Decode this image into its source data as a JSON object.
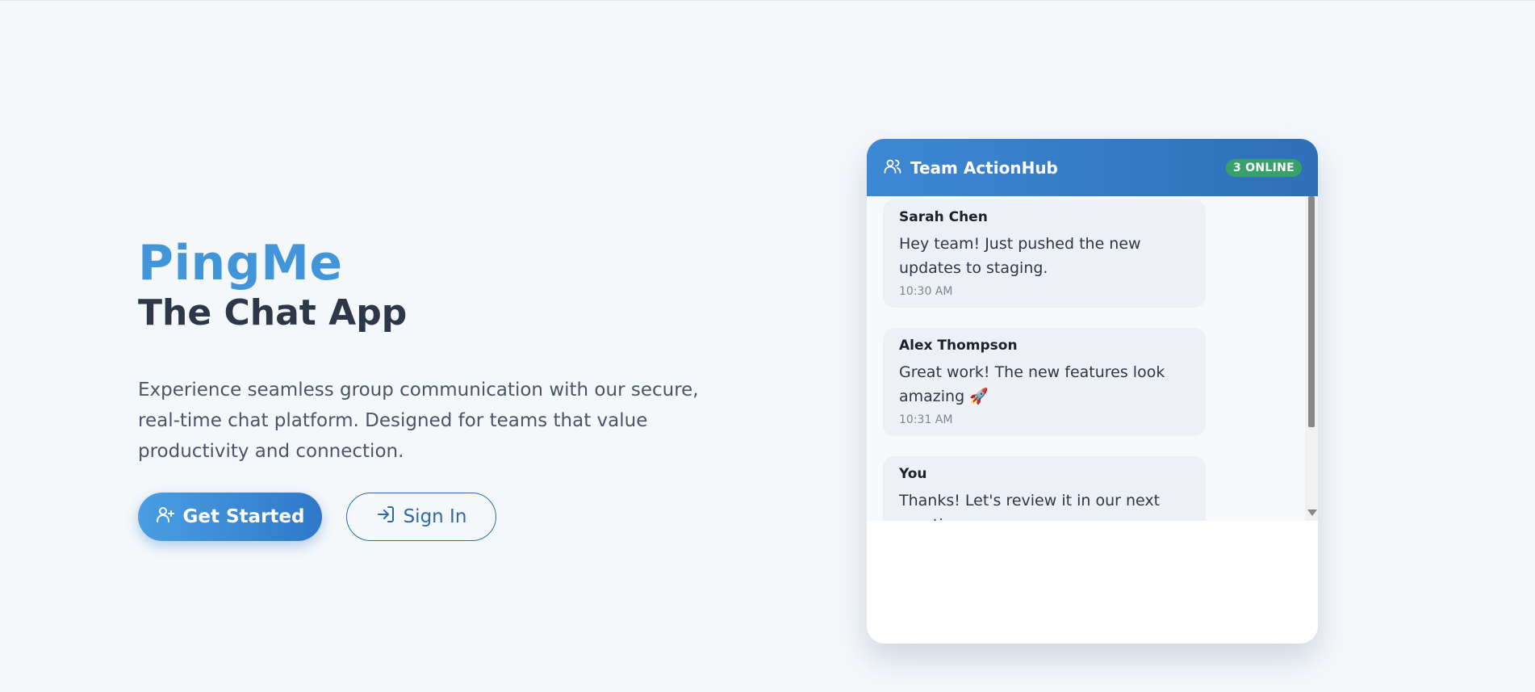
{
  "hero": {
    "brand": "PingMe",
    "subtitle": "The Chat App",
    "description": "Experience seamless group communication with our secure, real-time chat platform. Designed for teams that value productivity and connection.",
    "primary_button": "Get Started",
    "secondary_button": "Sign In"
  },
  "chat": {
    "title": "Team ActionHub",
    "online_badge": "3 ONLINE",
    "messages": [
      {
        "sender": "Sarah Chen",
        "text": "Hey team! Just pushed the new updates to staging.",
        "time": "10:30 AM"
      },
      {
        "sender": "Alex Thompson",
        "text": "Great work! The new features look amazing 🚀",
        "time": "10:31 AM"
      },
      {
        "sender": "You",
        "text": "Thanks! Let's review it in our next meeting.",
        "time": ""
      }
    ]
  },
  "colors": {
    "brand": "#4395d9",
    "primary": "#2f78c8",
    "online": "#38a169",
    "background": "#f5f8fb"
  },
  "icons": {
    "primary_button_icon": "user-plus-icon",
    "secondary_button_icon": "sign-in-icon",
    "header_icon": "users-icon"
  }
}
